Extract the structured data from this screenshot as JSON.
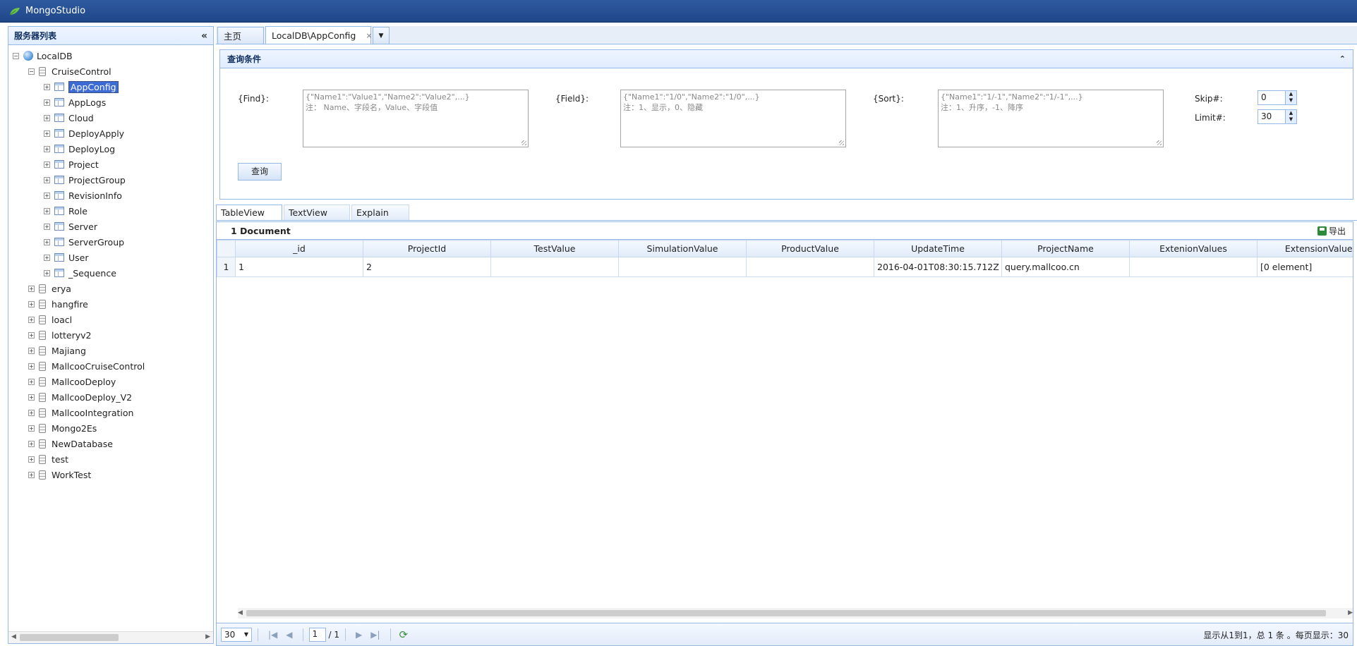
{
  "app": {
    "title": "MongoStudio"
  },
  "sidebar": {
    "title": "服务器列表",
    "server": "LocalDB",
    "expanded_db": "CruiseControl",
    "collections": [
      "AppConfig",
      "AppLogs",
      "Cloud",
      "DeployApply",
      "DeployLog",
      "Project",
      "ProjectGroup",
      "RevisionInfo",
      "Role",
      "Server",
      "ServerGroup",
      "User",
      "_Sequence"
    ],
    "selected_collection": "AppConfig",
    "databases": [
      "erya",
      "hangfire",
      "loacl",
      "lotteryv2",
      "Majiang",
      "MallcooCruiseControl",
      "MallcooDeploy",
      "MallcooDeploy_V2",
      "MallcooIntegration",
      "Mongo2Es",
      "NewDatabase",
      "test",
      "WorkTest"
    ]
  },
  "tabs": [
    {
      "label": "主页"
    },
    {
      "label": "LocalDB\\AppConfig",
      "close": "×"
    }
  ],
  "query": {
    "title": "查询条件",
    "find_label": "{Find}:",
    "find_placeholder_1": "{\"Name1\":\"Value1\",\"Name2\":\"Value2\",...}",
    "find_placeholder_2": "注：  Name、字段名，Value、字段值",
    "field_label": "{Field}:",
    "field_placeholder_1": "{\"Name1\":\"1/0\",\"Name2\":\"1/0\",...}",
    "field_placeholder_2": "注：1、显示，0、隐藏",
    "sort_label": "{Sort}:",
    "sort_placeholder_1": "{\"Name1\":\"1/-1\",\"Name2\":\"1/-1\",...}",
    "sort_placeholder_2": "注：1、升序，-1、降序",
    "skip_label": "Skip#:",
    "skip_value": "0",
    "limit_label": "Limit#:",
    "limit_value": "30",
    "button_label": "查询"
  },
  "view_tabs": [
    "TableView",
    "TextView",
    "Explain"
  ],
  "grid": {
    "count_label": "1 Document",
    "export_label": "导出",
    "columns": [
      "_id",
      "ProjectId",
      "TestValue",
      "SimulationValue",
      "ProductValue",
      "UpdateTime",
      "ProjectName",
      "ExtenionValues",
      "ExtensionValues"
    ],
    "rows": [
      {
        "rownum": "1",
        "cells": [
          "1",
          "2",
          "",
          "",
          "",
          "2016-04-01T08:30:15.712Z",
          "query.mallcoo.cn",
          "",
          "[0 element]"
        ]
      }
    ]
  },
  "pager": {
    "page_size": "30",
    "page_number": "1",
    "page_total": "/ 1",
    "info": "显示从1到1，总 1 条 。每页显示：30"
  },
  "icons": {
    "logo": "leaf-logo-icon",
    "collapse": "double-chevron-left-icon",
    "server": "globe-icon",
    "database": "database-icon",
    "collection": "table-icon",
    "export": "save-icon",
    "refresh": "refresh-icon"
  }
}
